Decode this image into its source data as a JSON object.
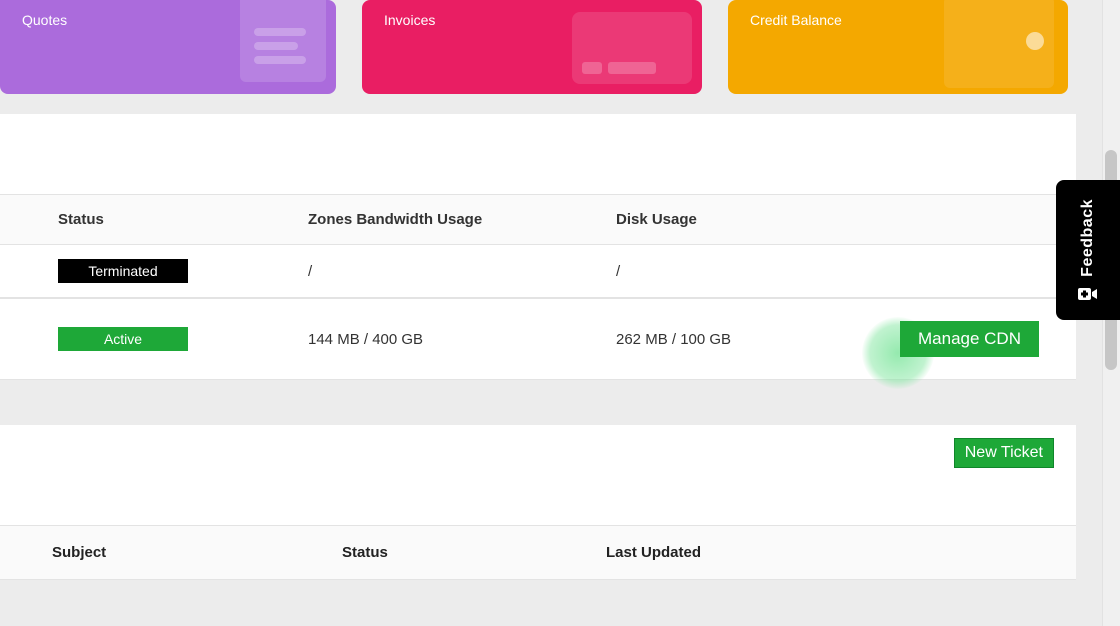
{
  "cards": {
    "quotes": {
      "label": "Quotes"
    },
    "invoices": {
      "label": "Invoices"
    },
    "credit": {
      "label": "Credit Balance"
    }
  },
  "usage_table": {
    "headers": {
      "status": "Status",
      "zones": "Zones Bandwidth Usage",
      "disk": "Disk Usage"
    },
    "rows": [
      {
        "status_label": "Terminated",
        "status_class": "terminated",
        "zones": "/",
        "disk": "/"
      },
      {
        "status_label": "Active",
        "status_class": "active",
        "zones": "144 MB / 400 GB",
        "disk": "262 MB / 100 GB",
        "action_label": "Manage CDN"
      }
    ]
  },
  "tickets": {
    "new_ticket_label": "New Ticket",
    "headers": {
      "subject": "Subject",
      "status": "Status",
      "last_updated": "Last Updated"
    }
  },
  "feedback": {
    "label": "Feedback"
  }
}
